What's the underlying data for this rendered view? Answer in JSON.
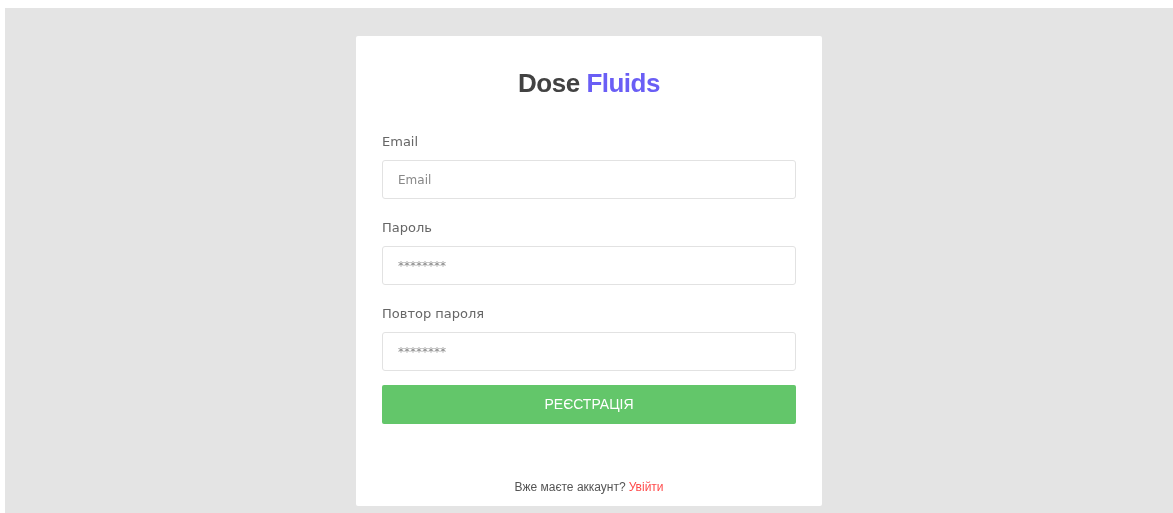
{
  "brand": {
    "name": "Dose",
    "accent": "Fluids"
  },
  "fields": [
    {
      "label": "Email",
      "placeholder": "Email"
    },
    {
      "label": "Пароль",
      "placeholder": "********"
    },
    {
      "label": "Повтор пароля",
      "placeholder": "********"
    }
  ],
  "submit": "РЕЄСТРАЦІЯ",
  "footer": {
    "text": "Вже маєте аккаунт?",
    "link": "Увійти"
  }
}
